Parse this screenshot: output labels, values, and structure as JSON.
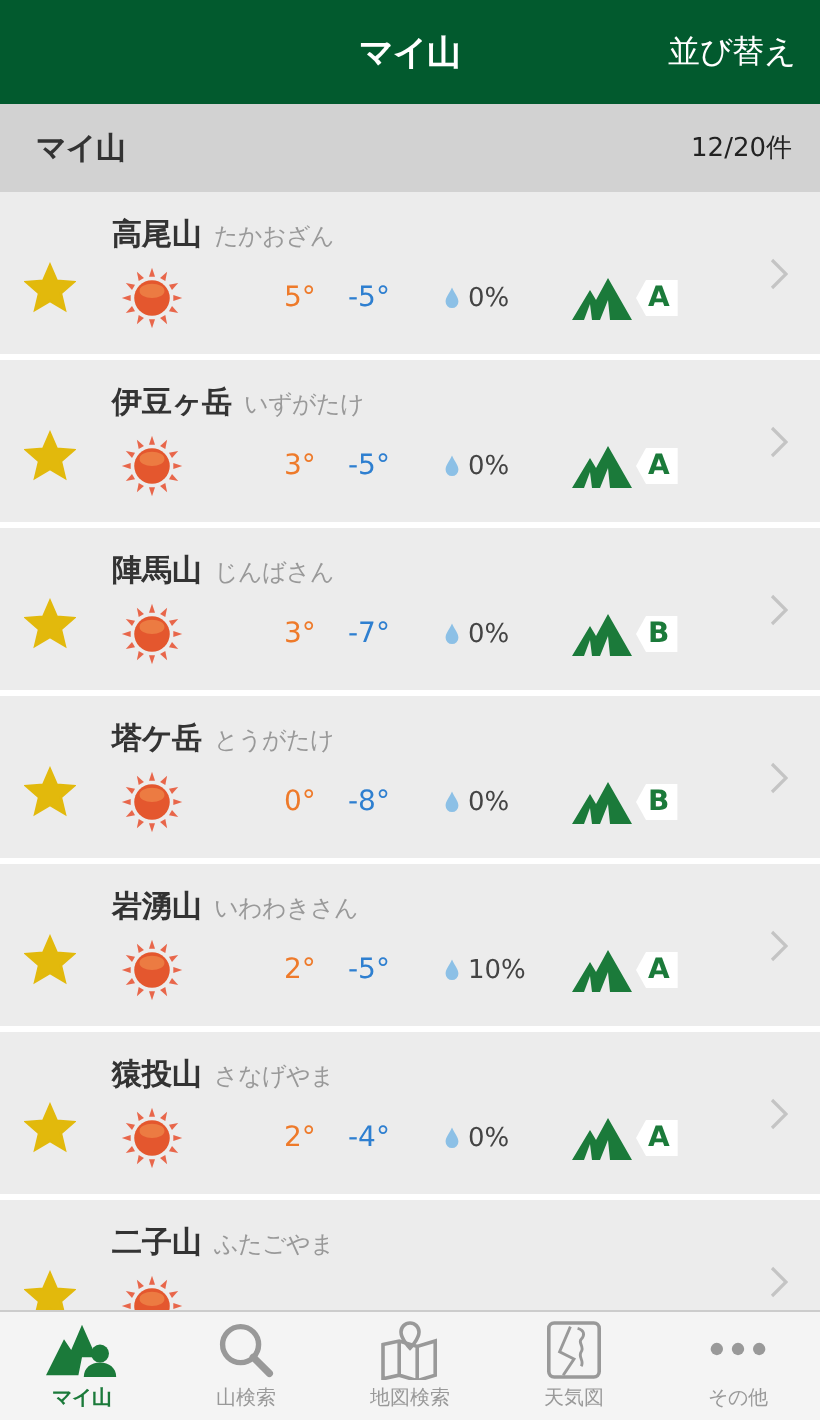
{
  "header": {
    "title": "マイ山",
    "sort_button": "並び替え"
  },
  "section": {
    "title": "マイ山",
    "count": "12/20件"
  },
  "mountains": [
    {
      "name": "高尾山",
      "reading": "たかおざん",
      "favorite": true,
      "high": "5°",
      "low": "-5°",
      "precip": "0%",
      "grade": "A"
    },
    {
      "name": "伊豆ヶ岳",
      "reading": "いずがたけ",
      "favorite": true,
      "high": "3°",
      "low": "-5°",
      "precip": "0%",
      "grade": "A"
    },
    {
      "name": "陣馬山",
      "reading": "じんばさん",
      "favorite": true,
      "high": "3°",
      "low": "-7°",
      "precip": "0%",
      "grade": "B"
    },
    {
      "name": "塔ケ岳",
      "reading": "とうがたけ",
      "favorite": true,
      "high": "0°",
      "low": "-8°",
      "precip": "0%",
      "grade": "B"
    },
    {
      "name": "岩湧山",
      "reading": "いわわきさん",
      "favorite": true,
      "high": "2°",
      "low": "-5°",
      "precip": "10%",
      "grade": "A"
    },
    {
      "name": "猿投山",
      "reading": "さなげやま",
      "favorite": true,
      "high": "2°",
      "low": "-4°",
      "precip": "0%",
      "grade": "A"
    },
    {
      "name": "二子山",
      "reading": "ふたごやま",
      "favorite": true
    }
  ],
  "tabs": [
    {
      "label": "マイ山",
      "kind": "mymountain",
      "selected": true
    },
    {
      "label": "山検索",
      "kind": "search",
      "selected": false
    },
    {
      "label": "地図検索",
      "kind": "map",
      "selected": false
    },
    {
      "label": "天気図",
      "kind": "weather",
      "selected": false
    },
    {
      "label": "その他",
      "kind": "more",
      "selected": false
    }
  ]
}
